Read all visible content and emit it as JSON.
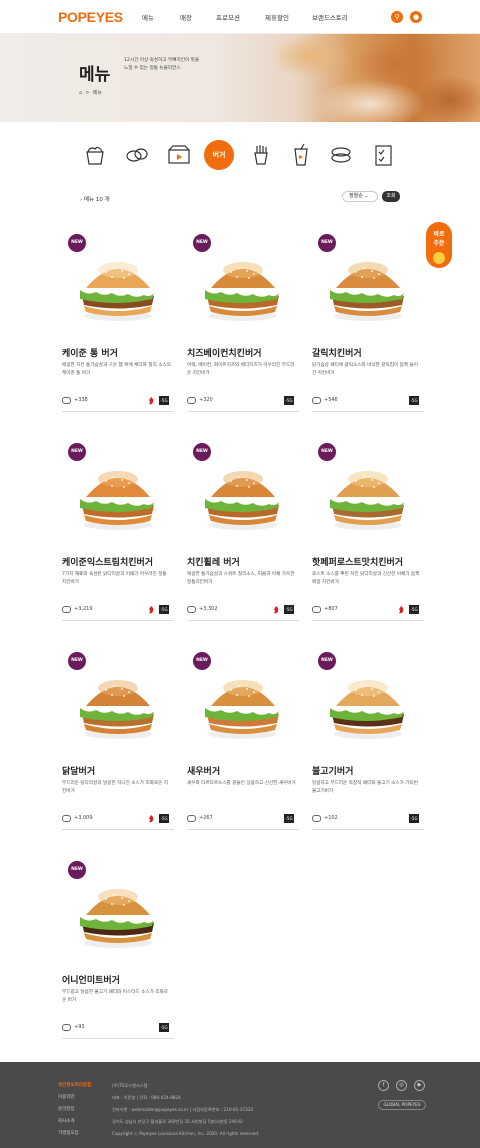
{
  "header": {
    "logo": "POPEYES",
    "nav": [
      "메뉴",
      "매장",
      "프로모션",
      "제휴할인",
      "브랜드스토리"
    ],
    "icon_search": "search-icon",
    "icon_user": "user-icon"
  },
  "hero": {
    "title": "메뉴",
    "desc_line1": "12시간 이상 숙성하고 무뼈치킨이 맛을",
    "desc_line2": "느낄 수 있는 정통 뉴올리언스",
    "breadcrumb_home": "⌂",
    "breadcrumb_sep": ">",
    "breadcrumb_current": "메뉴"
  },
  "categories": {
    "selected_label": "버거",
    "icons": [
      "chicken-bucket-icon",
      "chicken-pieces-icon",
      "combo-box-icon",
      "burger-icon",
      "fries-icon",
      "drink-icon",
      "dessert-icon",
      "checklist-icon"
    ]
  },
  "list": {
    "count": "메뉴 10 개",
    "sort_value": "정렬순",
    "sort_button": "조회"
  },
  "floating": {
    "line1": "바로",
    "line2": "주문"
  },
  "menu": [
    {
      "name": "케이준 통 버거",
      "desc": "매콤한 치킨 통가슴살과 구운 햄 위에 체더와 칠리 소스의 케이준 통 버거",
      "comments": "+338",
      "badge": "NEW",
      "hot": true
    },
    {
      "name": "치즈베이컨치킨버거",
      "desc": "어랙, 베이컨, 화이트치즈와 체더치즈가 어우러진 부드러운 치킨버거",
      "comments": "+320",
      "badge": "NEW",
      "hot": false
    },
    {
      "name": "갈릭치킨버거",
      "desc": "닭가슴살 패티에 갈릭소스와 바삭한 갈릭칩이 듬뿍 들어간 치킨버거",
      "comments": "+546",
      "badge": "NEW",
      "hot": false
    },
    {
      "name": "케이준익스트림치킨버거",
      "desc": "7가지 재료와 숙성된 닭다리살과 어패가 어우러진 정통 치킨버거",
      "comments": "+3,219",
      "badge": "NEW",
      "hot": true
    },
    {
      "name": "치킨휠레 버거",
      "desc": "매콤한 통가슴살과 스위트 칠리소스, 피클과 어채 가득한 정통치킨버거",
      "comments": "+3,302",
      "badge": "NEW",
      "hot": true
    },
    {
      "name": "핫페퍼로스트맛치킨버거",
      "desc": "로스트 소스를 뿌린 치킨 닭다리살과 신선한 야채가 듬뿍 매콤 치킨버거",
      "comments": "+807",
      "badge": "NEW",
      "hot": true
    },
    {
      "name": "닭달버거",
      "desc": "부드러운 닭다리살과 달콤한 허니진 소스가 조화로운 치킨버거",
      "comments": "+3,009",
      "badge": "NEW",
      "hot": true
    },
    {
      "name": "새우버거",
      "desc": "새우와 타르타르소스를 곁들인 상큼하고 신선한 새우버거",
      "comments": "+267",
      "badge": "NEW",
      "hot": false
    },
    {
      "name": "불고기버거",
      "desc": "달콤하고 부드러운 독창적 패티와 불고기 소스가 가미된 불고기버거",
      "comments": "+102",
      "badge": "NEW",
      "hot": false
    },
    {
      "name": "어니언미트버거",
      "desc": "부드럽고 달콤한 불고기 패티와 머스타드 소스가 조화로운 버거",
      "comments": "+93",
      "badge": "NEW",
      "hot": false
    }
  ],
  "age_label": "-5G",
  "footer": {
    "links": [
      "개인정보처리방침",
      "이용약관",
      "윤리헌장",
      "회사소개",
      "가맹점모집"
    ],
    "info": [
      "(주)TS푸드앤시스템",
      "대표 : 이문영  |  전화 : 080-424-8824",
      "전자우편 : webmaster@popeyes.co.kr  |  사업자등록번호 : 219-81-37332",
      "경기도 성남시 분당구 황새울로 360번길 35 서현빌딩 5층(서현동 246-6)",
      "Copyright ⓒ Popeyes Louisiana Kitchen, Inc. 2020. All rights reserved."
    ],
    "global": "GLOBAL POPEYES",
    "social": [
      "facebook-icon",
      "instagram-icon",
      "youtube-icon"
    ]
  }
}
